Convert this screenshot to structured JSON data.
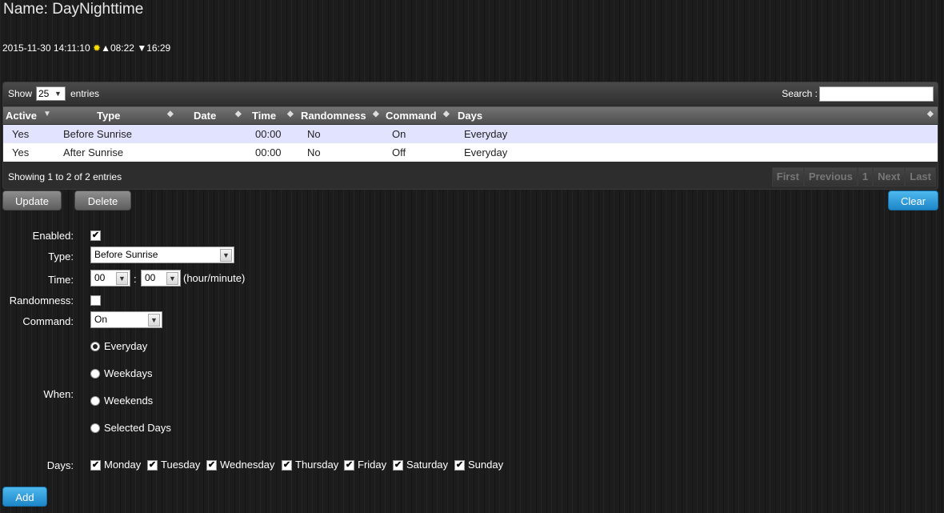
{
  "page": {
    "title": "Name: DayNighttime",
    "datetime": "2015-11-30 14:11:10",
    "sunrise": "▲08:22",
    "sunset": "▼16:29"
  },
  "table": {
    "show_label": "Show",
    "page_size": "25",
    "entries_label": "entries",
    "search_label": "Search :",
    "search_value": "",
    "columns": [
      "Active",
      "Type",
      "Date",
      "Time",
      "Randomness",
      "Command",
      "Days"
    ],
    "rows": [
      {
        "active": "Yes",
        "type": "Before Sunrise",
        "date": "",
        "time": "00:00",
        "randomness": "No",
        "command": "On",
        "days": "Everyday"
      },
      {
        "active": "Yes",
        "type": "After Sunrise",
        "date": "",
        "time": "00:00",
        "randomness": "No",
        "command": "Off",
        "days": "Everyday"
      }
    ],
    "info": "Showing 1 to 2 of 2 entries",
    "pager": {
      "first": "First",
      "previous": "Previous",
      "current": "1",
      "next": "Next",
      "last": "Last"
    }
  },
  "actions": {
    "update": "Update",
    "delete": "Delete",
    "clear": "Clear",
    "add": "Add"
  },
  "form": {
    "enabled_label": "Enabled:",
    "enabled": true,
    "type_label": "Type:",
    "type_value": "Before Sunrise",
    "time_label": "Time:",
    "hour": "00",
    "minute": "00",
    "time_sep": ":",
    "time_hint": "(hour/minute)",
    "randomness_label": "Randomness:",
    "randomness": false,
    "command_label": "Command:",
    "command_value": "On",
    "when_label": "When:",
    "when_options": [
      "Everyday",
      "Weekdays",
      "Weekends",
      "Selected Days"
    ],
    "when_selected": "Everyday",
    "days_label": "Days:",
    "days": [
      "Monday",
      "Tuesday",
      "Wednesday",
      "Thursday",
      "Friday",
      "Saturday",
      "Sunday"
    ]
  },
  "colors": {
    "accent_blue": "#2a9ad8",
    "row_highlight": "#e2e4ff",
    "sun_icon": "#ffe000"
  }
}
